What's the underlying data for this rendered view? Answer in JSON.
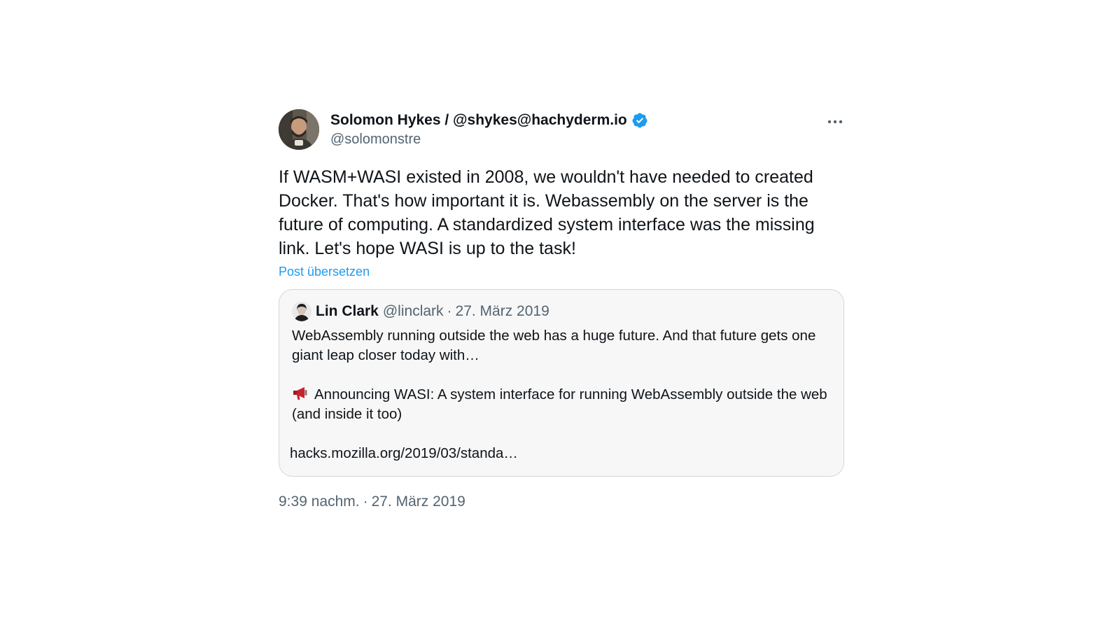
{
  "tweet": {
    "author": {
      "display_name": "Solomon Hykes / @shykes@hachyderm.io",
      "handle": "@solomonstre",
      "avatar_icon": "user-avatar-photo",
      "verified_icon": "verified-badge-icon",
      "verified_color": "#1d9bf0"
    },
    "more_icon": "more-horizontal-icon",
    "text": "If WASM+WASI existed in 2008, we wouldn't have needed to created Docker. That's how important it is. Webassembly on the server is the future of computing. A standardized system interface was the missing link. Let's hope WASI is up to the task!",
    "translate_label": "Post übersetzen",
    "quoted": {
      "display_name": "Lin Clark",
      "handle": "@linclark",
      "separator": "·",
      "date": "27. März 2019",
      "paragraph1": "WebAssembly running outside the web has a huge future. And that future gets one giant leap closer today with…",
      "paragraph2_icon": "megaphone-icon",
      "paragraph2": "Announcing WASI: A system interface for running WebAssembly outside the web (and inside it too)",
      "link": "hacks.mozilla.org/2019/03/standa…"
    },
    "footer": {
      "time": "9:39 nachm.",
      "separator": "·",
      "date": "27. März 2019"
    }
  },
  "colors": {
    "accent": "#1d9bf0",
    "text_primary": "#0f1419",
    "text_secondary": "#536471",
    "quote_background": "#f7f7f7",
    "quote_border": "#cfd9de"
  }
}
